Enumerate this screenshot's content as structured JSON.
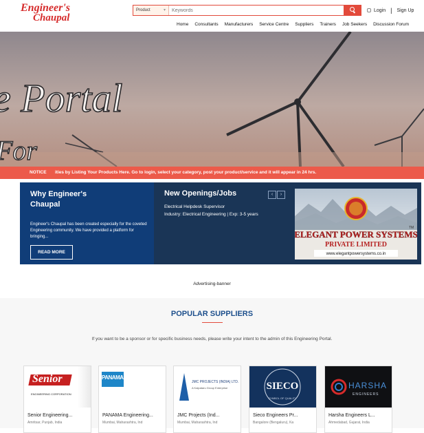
{
  "brand": {
    "line1": "Engineer's",
    "line2": "Chaupal",
    "color": "#d62b2b"
  },
  "search": {
    "category": "Product",
    "placeholder": "Keywords",
    "button_icon": "search-icon"
  },
  "auth": {
    "login": "Login",
    "signup": "Sign Up"
  },
  "nav": [
    "Home",
    "Consultants",
    "Manufacturers",
    "Service Centre",
    "Suppliers",
    "Trainers",
    "Job Seekers",
    "Discussion Forum"
  ],
  "hero": {
    "text_line1": "e Portal",
    "text_line2": "For"
  },
  "notice": {
    "tag": "NOTICE",
    "message": "ities by Listing Your Products Here. Go to login, select your category, post your product/service and it will appear in 24 hrs."
  },
  "why": {
    "title": "Why Engineer's Chaupal",
    "body": "Engineer's Chaupal has been created especially for the coveted Engineering community. We have provided a platform for bringing...",
    "button": "READ MORE"
  },
  "jobs": {
    "title": "New Openings/Jobs",
    "prev": "‹",
    "next": "›",
    "item_title": "Electrical Helpdesk Supervisor",
    "item_detail": "Industry: Electrical Engineering | Exp: 3-5 years"
  },
  "ad": {
    "company_line1": "ELEGANT POWER SYSTEMS",
    "company_line2": "PRIVATE LIMITED",
    "tm": "TM",
    "website": "www.elegantpowersystems.co.in",
    "banner_label": "Advertising-banner"
  },
  "popular": {
    "title": "POPULAR SUPPLIERS",
    "info": "If you want to be a sponsor or for specific business needs, please write your intent to the admin of this Engineering Portal.",
    "suppliers": [
      {
        "name": "Senior Engineering...",
        "location": "Amritsar, Punjab, India",
        "logo_text": "Senior",
        "logo_sub": "ENGINEERING CORPORATION"
      },
      {
        "name": "PANAMA Engineering...",
        "location": "Mumbai, Maharashtra, Ind",
        "logo_text": "PANAMA"
      },
      {
        "name": "JMC Projects (Ind...",
        "location": "Mumbai, Maharashtra, Ind",
        "logo_text": "JMC PROJECTS (INDIA) LTD.",
        "logo_sub": "A Kalpataru Group Enterprise"
      },
      {
        "name": "Sieco Engineers Pr...",
        "location": "Bangalore (Bengaluru), Ka",
        "logo_text": "SIECO",
        "logo_sub": "SYMBOL OF QUALITY"
      },
      {
        "name": "Harsha Engineers L...",
        "location": "Ahmedabad, Gujarat, India",
        "logo_text": "HARSHA",
        "logo_sub": "ENGINEERS"
      }
    ]
  },
  "colors": {
    "accent": "#e24a3b",
    "navy": "#103d78",
    "title_blue": "#1d4f8c"
  }
}
